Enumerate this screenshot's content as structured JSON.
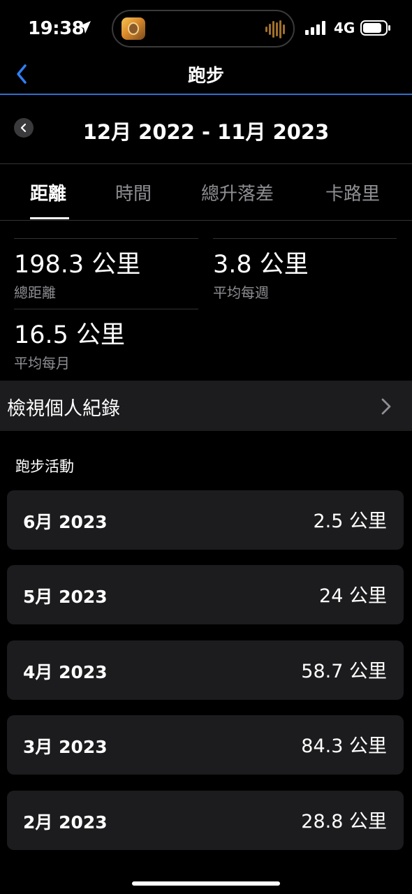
{
  "status_bar": {
    "time": "19:38",
    "network": "4G"
  },
  "nav": {
    "title": "跑步"
  },
  "date_range": {
    "label": "12月 2022 - 11月 2023"
  },
  "tabs": [
    {
      "label": "距離",
      "active": true
    },
    {
      "label": "時間",
      "active": false
    },
    {
      "label": "總升落差",
      "active": false
    },
    {
      "label": "卡路里",
      "active": false
    }
  ],
  "stats": {
    "total_distance": {
      "value": "198.3 公里",
      "label": "總距離"
    },
    "weekly_avg": {
      "value": "3.8 公里",
      "label": "平均每週"
    },
    "monthly_avg": {
      "value": "16.5 公里",
      "label": "平均每月"
    }
  },
  "records": {
    "label": "檢視個人紀錄"
  },
  "activities": {
    "heading": "跑步活動",
    "items": [
      {
        "month": "6月 2023",
        "distance": "2.5 公里"
      },
      {
        "month": "5月 2023",
        "distance": "24 公里"
      },
      {
        "month": "4月 2023",
        "distance": "58.7 公里"
      },
      {
        "month": "3月 2023",
        "distance": "84.3 公里"
      },
      {
        "month": "2月 2023",
        "distance": "28.8 公里"
      }
    ]
  },
  "colors": {
    "accent": "#2f6fd0",
    "card_bg": "#1c1c1e",
    "secondary_text": "#8e8e93"
  }
}
